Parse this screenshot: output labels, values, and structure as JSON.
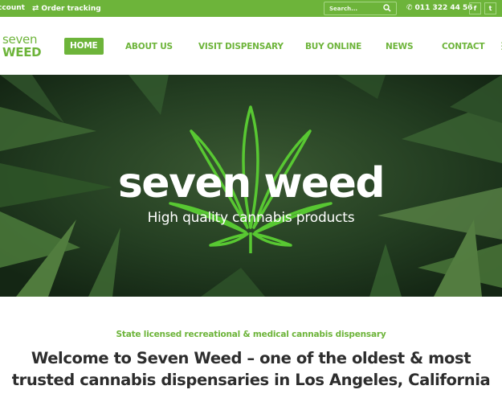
{
  "topbar": {
    "account": "ccount",
    "order_tracking": "Order tracking",
    "search_placeholder": "Search...",
    "phone": "011 322 44 56",
    "social": {
      "facebook": "f",
      "twitter": "t"
    }
  },
  "header": {
    "logo_line1": "seven",
    "logo_line2": "WEED",
    "nav": {
      "home": "HOME",
      "about": "ABOUT US",
      "visit": "VISIT DISPENSARY",
      "buy": "BUY ONLINE",
      "news": "NEWS",
      "contact": "CONTACT"
    }
  },
  "hero": {
    "title": "seven weed",
    "subtitle": "High quality cannabis products"
  },
  "intro": {
    "kicker": "State licensed recreational & medical cannabis dispensary",
    "title": "Welcome to Seven Weed – one of the oldest & most trusted cannabis dispensaries in Los Angeles, California"
  },
  "colors": {
    "brand_green": "#6db43a",
    "dark_text": "#2d2d2d",
    "hero_background": "#213a1e"
  },
  "icons": [
    "transfer-arrows-icon",
    "search-icon",
    "phone-icon",
    "facebook-icon",
    "twitter-icon",
    "cannabis-leaf-icon",
    "more-icon"
  ]
}
